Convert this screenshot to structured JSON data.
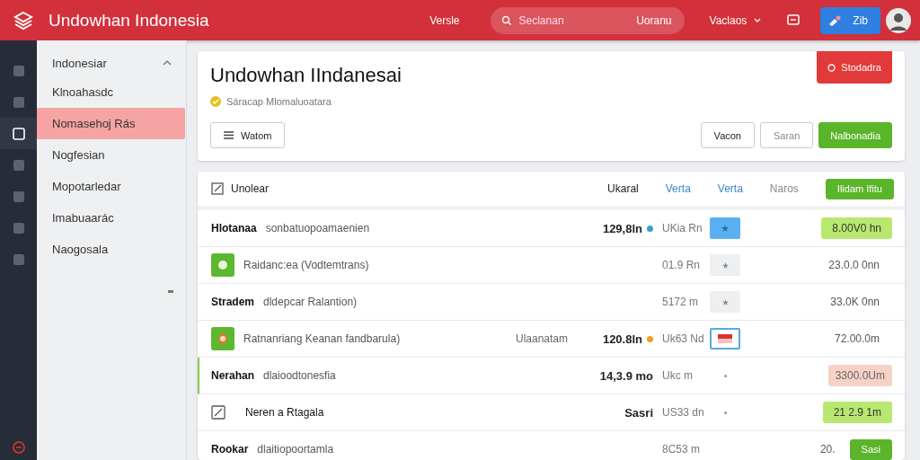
{
  "header": {
    "brand": "Undowhan Indonesia",
    "link": "Versle",
    "search": {
      "placeholder": "Seclanan",
      "suffix": "Uoranu"
    },
    "menu": "Vaclaos",
    "action": "Zib"
  },
  "rail": [
    {
      "selected": false
    },
    {
      "selected": false
    },
    {
      "selected": true
    },
    {
      "selected": false
    },
    {
      "selected": false
    },
    {
      "selected": false
    },
    {
      "selected": false
    }
  ],
  "sidebar": {
    "title": "Indonesiar",
    "expanded": true,
    "items": [
      {
        "label": "Klnoahasdc",
        "selected": false
      },
      {
        "label": "Nomasehoj Rás",
        "selected": true
      },
      {
        "label": "Nogfesian",
        "selected": false
      },
      {
        "label": "Mopotarledar",
        "selected": false
      },
      {
        "label": "Imabuaarác",
        "selected": false
      },
      {
        "label": "Naogosala",
        "selected": false
      }
    ]
  },
  "page": {
    "title": "Undowhan IIndanesai",
    "status": "Sáracap Mlomaluoatara",
    "alert": "Stodadra",
    "menu_button": "Watom",
    "buttons": [
      {
        "label": "Vacon",
        "kind": "outline"
      },
      {
        "label": "Saran",
        "kind": "muted"
      },
      {
        "label": "Nalbonadia",
        "kind": "primary"
      }
    ]
  },
  "table": {
    "title": "Unolear",
    "columns": [
      {
        "label": "Ukaral",
        "kind": "dark"
      },
      {
        "label": "Verta",
        "kind": "link"
      },
      {
        "label": "Verta",
        "kind": "link"
      },
      {
        "label": "Naros",
        "kind": "muted"
      }
    ],
    "action": "Ilidam Ifitu",
    "rows": [
      {
        "name": "Hlotanaa",
        "description": "sonbatuopoamaenien",
        "amount": "129,8ln",
        "color": "#3aa0d0",
        "unit": "UKia Rn",
        "chip": {
          "kind": "blue"
        },
        "value": {
          "text": "8.00V0 hn",
          "kind": "green"
        },
        "accent": false
      },
      {
        "lead": {
          "kind": "leaf"
        },
        "description": "Raidanc:ea (Vodtemtrans)",
        "unit": "01.9 Rn",
        "chip": {
          "kind": "gray"
        },
        "value": {
          "text": "23.0.0 0nn",
          "kind": "plain"
        },
        "accent": false
      },
      {
        "name": "Stradem",
        "description": "dldepcar Ralantion)",
        "unit": "5172 m",
        "chip": {
          "kind": "gray"
        },
        "value": {
          "text": "33.0K 0nn",
          "kind": "plain"
        },
        "accent": false
      },
      {
        "lead": {
          "kind": "figure"
        },
        "description": "Ratnanriang Keanan fandbarula)",
        "note": "Ulaanatam",
        "amount": "120.8ln",
        "color": "#f0a020",
        "unit": "Uk63 Nd",
        "chip": {
          "kind": "flag"
        },
        "value": {
          "text": "72.00.0m",
          "kind": "plain"
        },
        "accent": false
      },
      {
        "name": "Nerahan",
        "description": "dlaioodtonesfia",
        "amount": "14,3.9 mo",
        "unit": "Ukc m",
        "chip": {
          "kind": "dot"
        },
        "value": {
          "text": "3300.0Um",
          "kind": "pink"
        },
        "accent": true
      },
      {
        "lead": {
          "kind": "checkbox"
        },
        "title": "Neren a Rtagala",
        "amount": "Sasri",
        "unit": "US33 dn",
        "chip": {
          "kind": "dot"
        },
        "value": {
          "text": "21 2.9 1m",
          "kind": "green"
        },
        "accent": false
      },
      {
        "name": "Rookar",
        "description": "dlaitiopoortamla",
        "unit": "8C53 m",
        "value": {
          "text": "20.",
          "kind": "plain"
        },
        "button": "Sasi",
        "accent": false
      }
    ]
  }
}
